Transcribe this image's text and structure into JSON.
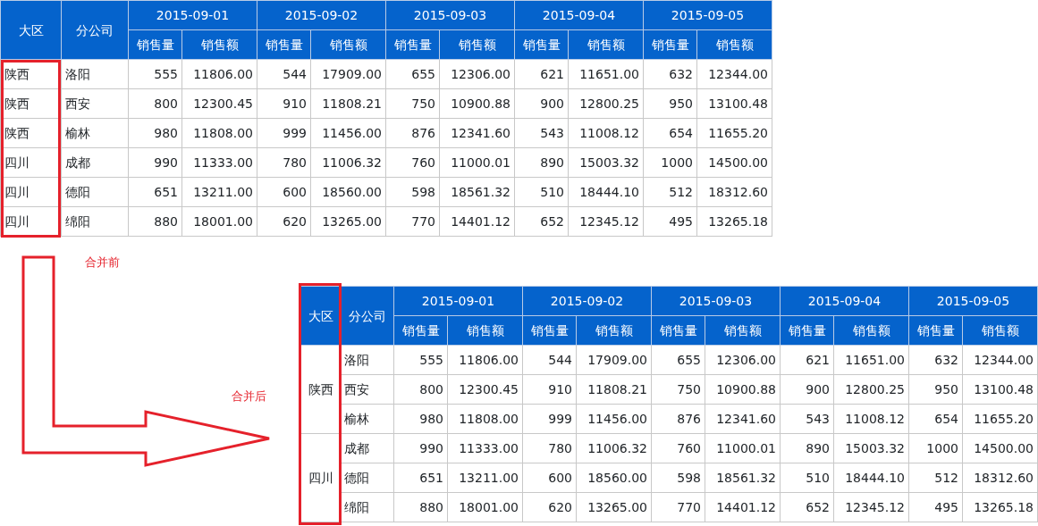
{
  "before_table": {
    "headers": {
      "region": "大区",
      "branch": "分公司",
      "dates": [
        {
          "date": "2015-09-01",
          "sub": [
            "销售量",
            "销售额"
          ]
        },
        {
          "date": "2015-09-02",
          "sub": [
            "销售量",
            "销售额"
          ]
        },
        {
          "date": "2015-09-03",
          "sub": [
            "销售量",
            "销售额"
          ]
        },
        {
          "date": "2015-09-04",
          "sub": [
            "销售量",
            "销售额"
          ]
        },
        {
          "date": "2015-09-05",
          "sub": [
            "销售量",
            "销售额"
          ]
        }
      ]
    },
    "rows": [
      {
        "region": "陕西",
        "branch": "洛阳",
        "values": [
          "555",
          "11806.00",
          "544",
          "17909.00",
          "655",
          "12306.00",
          "621",
          "11651.00",
          "632",
          "12344.00"
        ]
      },
      {
        "region": "陕西",
        "branch": "西安",
        "values": [
          "800",
          "12300.45",
          "910",
          "11808.21",
          "750",
          "10900.88",
          "900",
          "12800.25",
          "950",
          "13100.48"
        ]
      },
      {
        "region": "陕西",
        "branch": "榆林",
        "values": [
          "980",
          "11808.00",
          "999",
          "11456.00",
          "876",
          "12341.60",
          "543",
          "11008.12",
          "654",
          "11655.20"
        ]
      },
      {
        "region": "四川",
        "branch": "成都",
        "values": [
          "990",
          "11333.00",
          "780",
          "11006.32",
          "760",
          "11000.01",
          "890",
          "15003.32",
          "1000",
          "14500.00"
        ]
      },
      {
        "region": "四川",
        "branch": "德阳",
        "values": [
          "651",
          "13211.00",
          "600",
          "18560.00",
          "598",
          "18561.32",
          "510",
          "18444.10",
          "512",
          "18312.60"
        ]
      },
      {
        "region": "四川",
        "branch": "绵阳",
        "values": [
          "880",
          "18001.00",
          "620",
          "13265.00",
          "770",
          "14401.12",
          "652",
          "12345.12",
          "495",
          "13265.18"
        ]
      }
    ]
  },
  "label_before": "合并前",
  "label_after": "合并后",
  "after_table": {
    "headers": {
      "region": "大区",
      "branch": "分公司",
      "dates": [
        {
          "date": "2015-09-01",
          "sub": [
            "销售量",
            "销售额"
          ]
        },
        {
          "date": "2015-09-02",
          "sub": [
            "销售量",
            "销售额"
          ]
        },
        {
          "date": "2015-09-03",
          "sub": [
            "销售量",
            "销售额"
          ]
        },
        {
          "date": "2015-09-04",
          "sub": [
            "销售量",
            "销售额"
          ]
        },
        {
          "date": "2015-09-05",
          "sub": [
            "销售量",
            "销售额"
          ]
        }
      ]
    },
    "regions": [
      {
        "region": "陕西",
        "branches": [
          {
            "branch": "洛阳",
            "values": [
              "555",
              "11806.00",
              "544",
              "17909.00",
              "655",
              "12306.00",
              "621",
              "11651.00",
              "632",
              "12344.00"
            ]
          },
          {
            "branch": "西安",
            "values": [
              "800",
              "12300.45",
              "910",
              "11808.21",
              "750",
              "10900.88",
              "900",
              "12800.25",
              "950",
              "13100.48"
            ]
          },
          {
            "branch": "榆林",
            "values": [
              "980",
              "11808.00",
              "999",
              "11456.00",
              "876",
              "12341.60",
              "543",
              "11008.12",
              "654",
              "11655.20"
            ]
          }
        ]
      },
      {
        "region": "四川",
        "branches": [
          {
            "branch": "成都",
            "values": [
              "990",
              "11333.00",
              "780",
              "11006.32",
              "760",
              "11000.01",
              "890",
              "15003.32",
              "1000",
              "14500.00"
            ]
          },
          {
            "branch": "德阳",
            "values": [
              "651",
              "13211.00",
              "600",
              "18560.00",
              "598",
              "18561.32",
              "510",
              "18444.10",
              "512",
              "18312.60"
            ]
          },
          {
            "branch": "绵阳",
            "values": [
              "880",
              "18001.00",
              "620",
              "13265.00",
              "770",
              "14401.12",
              "652",
              "12345.12",
              "495",
              "13265.18"
            ]
          }
        ]
      }
    ]
  }
}
